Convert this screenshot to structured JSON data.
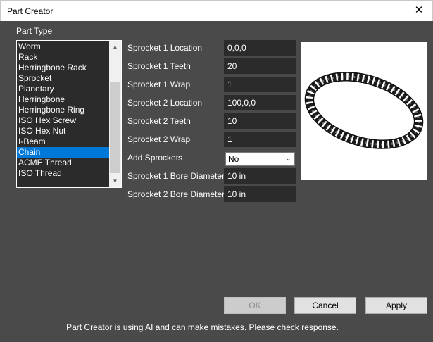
{
  "window": {
    "title": "Part Creator",
    "close_glyph": "✕"
  },
  "part_type": {
    "label": "Part Type",
    "items": [
      "Worm",
      "Rack",
      "Herringbone Rack",
      "Sprocket",
      "Planetary",
      "Herringbone",
      "Herringbone Ring",
      "ISO Hex Screw",
      "ISO Hex Nut",
      "I-Beam",
      "Chain",
      "ACME Thread",
      "ISO Thread"
    ],
    "selected": "Chain"
  },
  "params": {
    "sprocket1_location": {
      "label": "Sprocket 1 Location",
      "value": "0,0,0"
    },
    "sprocket1_teeth": {
      "label": "Sprocket 1 Teeth",
      "value": "20"
    },
    "sprocket1_wrap": {
      "label": "Sprocket 1 Wrap",
      "value": "1"
    },
    "sprocket2_location": {
      "label": "Sprocket 2 Location",
      "value": "100,0,0"
    },
    "sprocket2_teeth": {
      "label": "Sprocket 2 Teeth",
      "value": "10"
    },
    "sprocket2_wrap": {
      "label": "Sprocket 2 Wrap",
      "value": "1"
    },
    "add_sprockets": {
      "label": "Add Sprockets",
      "value": "No"
    },
    "sprocket1_bore": {
      "label": "Sprocket 1 Bore Diameter",
      "value": "10 in"
    },
    "sprocket2_bore": {
      "label": "Sprocket 2 Bore Diameter",
      "value": "10 in"
    }
  },
  "buttons": {
    "ok": "OK",
    "cancel": "Cancel",
    "apply": "Apply"
  },
  "disclaimer": "Part Creator is using AI and can make mistakes. Please check response.",
  "icons": {
    "close": "close-icon",
    "dropdown": "chevron-down-icon",
    "scroll_up": "arrow-up-icon",
    "scroll_down": "arrow-down-icon"
  },
  "colors": {
    "background": "#4a4a4a",
    "field": "#2b2b2b",
    "selection": "#0078d7"
  }
}
